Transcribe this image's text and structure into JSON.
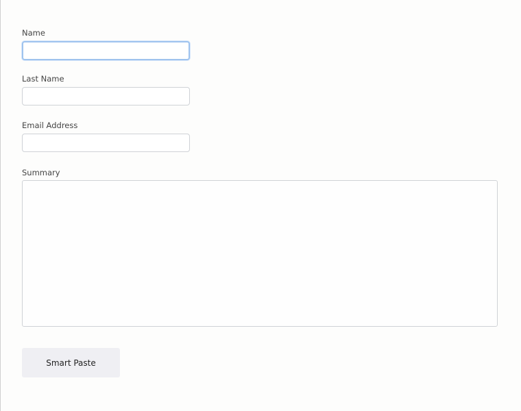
{
  "form": {
    "name": {
      "label": "Name",
      "value": "",
      "placeholder": ""
    },
    "last_name": {
      "label": "Last Name",
      "value": "",
      "placeholder": ""
    },
    "email": {
      "label": "Email Address",
      "value": "",
      "placeholder": ""
    },
    "summary": {
      "label": "Summary",
      "value": "",
      "placeholder": ""
    },
    "smart_paste_label": "Smart Paste"
  },
  "colors": {
    "focus_border": "#9fc3ee",
    "input_border": "#cfd2d6",
    "button_background": "#efeff3"
  }
}
